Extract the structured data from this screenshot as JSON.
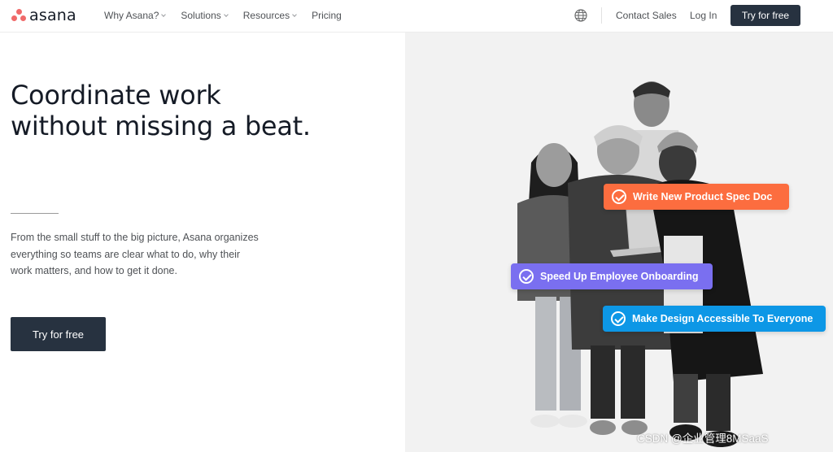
{
  "header": {
    "logo_text": "asana",
    "nav": [
      {
        "label": "Why Asana?",
        "dropdown": true
      },
      {
        "label": "Solutions",
        "dropdown": true
      },
      {
        "label": "Resources",
        "dropdown": true
      },
      {
        "label": "Pricing",
        "dropdown": false
      }
    ],
    "globe_icon": "globe-icon",
    "contact_label": "Contact Sales",
    "login_label": "Log In",
    "try_label": "Try for free"
  },
  "hero": {
    "headline_lines": [
      "Coordinate work",
      "without missing a beat."
    ],
    "body_lines": [
      "From the small stuff to the big picture, Asana organizes",
      "everything so teams are clear what to do, why their",
      "work matters, and how to get it done."
    ],
    "cta_label": "Try for free"
  },
  "tasks": [
    {
      "label": "Write New Product Spec Doc",
      "color": "#fc6d3f"
    },
    {
      "label": "Speed Up Employee Onboarding",
      "color": "#7a6ff0"
    },
    {
      "label": "Make Design Accessible To Everyone",
      "color": "#0d97e6"
    }
  ],
  "watermark": "CSDN @企业管理8MSaaS",
  "colors": {
    "brand_coral": "#f06a6a",
    "button_dark": "#273240",
    "photo_bg": "#f2f2f2"
  }
}
